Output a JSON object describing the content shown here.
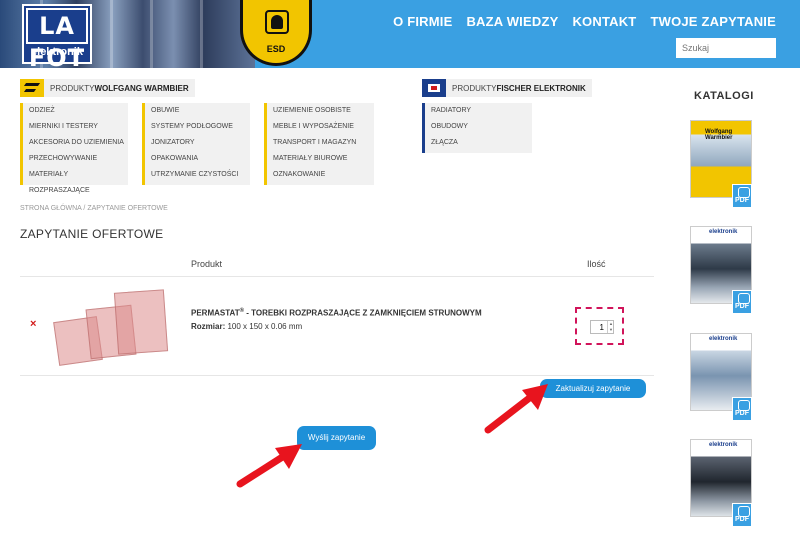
{
  "header": {
    "logo": {
      "letters": "LA FOT",
      "subtitle": "elektronik"
    },
    "esd_badge": "ESD",
    "nav": [
      {
        "label": "O FIRMIE"
      },
      {
        "label": "BAZA WIEDZY"
      },
      {
        "label": "KONTAKT"
      },
      {
        "label": "TWOJE ZAPYTANIE"
      }
    ],
    "search_placeholder": "Szukaj"
  },
  "groups": {
    "warmbier": {
      "prefix": "PRODUKTY ",
      "brand": "WOLFGANG WARMBIER",
      "columns": [
        [
          "ODZIEŻ",
          "MIERNIKI I TESTERY",
          "AKCESORIA DO UZIEMIENIA",
          "PRZECHOWYWANIE",
          "MATERIAŁY ROZPRASZAJĄCE"
        ],
        [
          "OBUWIE",
          "SYSTEMY PODŁOGOWE",
          "JONIZATORY",
          "OPAKOWANIA",
          "UTRZYMANIE CZYSTOŚCI"
        ],
        [
          "UZIEMIENIE OSOBISTE",
          "MEBLE I WYPOSAŻENIE",
          "TRANSPORT I MAGAZYN",
          "MATERIAŁY BIUROWE",
          "OZNAKOWANIE"
        ]
      ]
    },
    "fischer": {
      "prefix": "PRODUKTY ",
      "brand": "FISCHER ELEKTRONIK",
      "items": [
        "RADIATORY",
        "OBUDOWY",
        "ZŁĄCZA"
      ]
    }
  },
  "katalogi": {
    "title": "KATALOGI",
    "catalogs": [
      {
        "cover": "Wolfgang Warmbier",
        "badge": "PDF"
      },
      {
        "cover": "elektronik",
        "badge": "PDF"
      },
      {
        "cover": "elektronik",
        "badge": "PDF"
      },
      {
        "cover": "elektronik",
        "badge": "PDF"
      }
    ]
  },
  "breadcrumb": {
    "home": "STRONA GŁÓWNA",
    "sep": " / ",
    "current": "ZAPYTANIE OFERTOWE"
  },
  "page_title": "ZAPYTANIE OFERTOWE",
  "table": {
    "col_product": "Produkt",
    "col_qty": "Ilość",
    "row": {
      "remove": "×",
      "name_before": "PERMASTAT",
      "name_reg": "®",
      "name_after": " - TOREBKI ROZPRASZAJĄCE Z ZAMKNIĘCIEM STRUNOWYM",
      "size_label": "Rozmiar:",
      "size_value": " 100 x 150 x 0.06 mm",
      "quantity": "1"
    }
  },
  "buttons": {
    "update": "Zaktualizuj zapytanie",
    "send": "Wyślij zapytanie"
  },
  "colors": {
    "header_blue": "#3aa0e2",
    "button_blue": "#1e90d8",
    "brand_yellow": "#f2c500",
    "brand_navy": "#1a3e8c",
    "annotation_red": "#e8141e",
    "highlight_magenta": "#d1145a"
  }
}
